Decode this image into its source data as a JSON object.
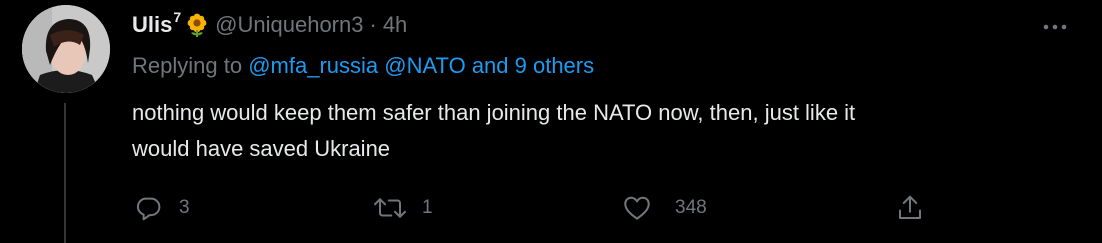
{
  "tweet": {
    "display_name": "Ulis",
    "superscript": "7",
    "name_emoji": "sunflower-emoji",
    "handle": "@Uniquehorn3",
    "separator": "·",
    "time": "4h",
    "replying_prefix": "Replying to",
    "replying_users": [
      "@mfa_russia",
      "@NATO"
    ],
    "replying_others": "and 9 others",
    "text_line1": "nothing would keep them safer than joining the NATO now, then, just like it",
    "text_line2": "would have saved Ukraine"
  },
  "actions": {
    "reply": {
      "icon": "reply-icon",
      "count": "3"
    },
    "retweet": {
      "icon": "retweet-icon",
      "count": "1"
    },
    "like": {
      "icon": "heart-icon",
      "count": "348"
    },
    "share": {
      "icon": "share-icon"
    }
  },
  "colors": {
    "background": "#000000",
    "primary_text": "#e7e9ea",
    "secondary_text": "#71767b",
    "link": "#1d9bf0",
    "thread_line": "#333639"
  }
}
